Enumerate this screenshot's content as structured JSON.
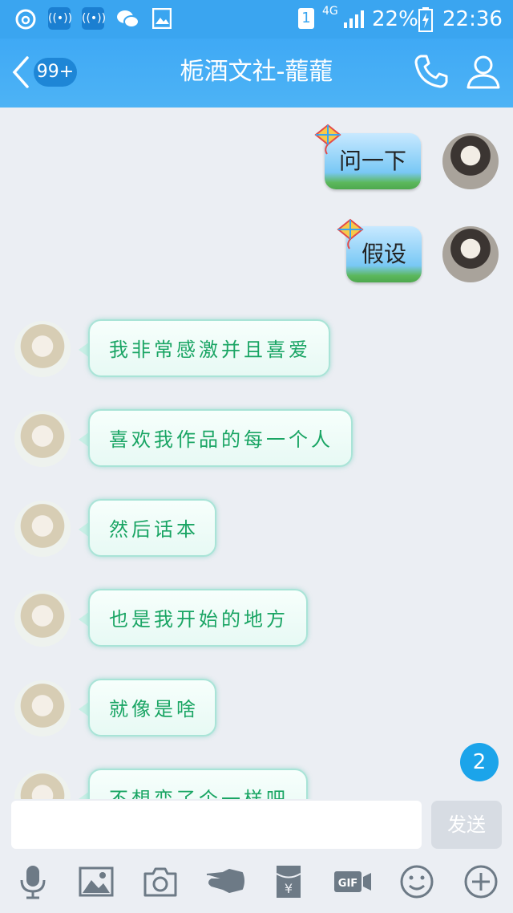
{
  "status_bar": {
    "sim": "1",
    "network": "4G",
    "battery": "22%",
    "time": "22:36"
  },
  "header": {
    "back_badge": "99+",
    "title": "栀酒文社-蘢蘢"
  },
  "messages": [
    {
      "side": "out",
      "text": "问一下"
    },
    {
      "side": "out",
      "text": "假设"
    },
    {
      "side": "in",
      "text": "我非常感激并且喜爱"
    },
    {
      "side": "in",
      "text": "喜欢我作品的每一个人"
    },
    {
      "side": "in",
      "text": "然后话本"
    },
    {
      "side": "in",
      "text": "也是我开始的地方"
    },
    {
      "side": "in",
      "text": "就像是啥"
    },
    {
      "side": "in",
      "text": "不想变了个一样吧"
    }
  ],
  "unread_count": "2",
  "input": {
    "value": "",
    "send_label": "发送"
  },
  "toolbar": {
    "gif_label": "GIF"
  },
  "colors": {
    "header_blue": "#3fa9f5",
    "incoming_text_green": "#1aa564",
    "badge_blue": "#1ba4ea"
  },
  "icons": [
    "voice-icon",
    "image-icon",
    "camera-icon",
    "poke-icon",
    "red-packet-icon",
    "gif-icon",
    "emoji-icon",
    "plus-icon"
  ]
}
